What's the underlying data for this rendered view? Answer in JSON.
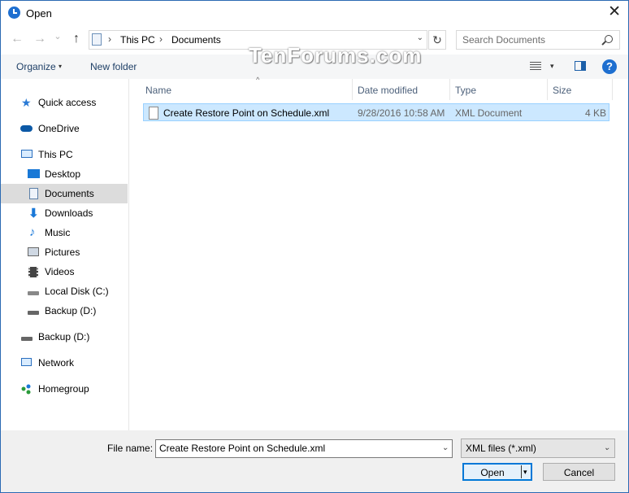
{
  "window": {
    "title": "Open",
    "close_glyph": "✕"
  },
  "nav": {
    "back_glyph": "←",
    "forward_glyph": "→",
    "recent_glyph": "⌄",
    "up_glyph": "↑"
  },
  "address": {
    "crumbs": [
      "This PC",
      "Documents"
    ],
    "separator": "›",
    "dropdown_glyph": "⌄",
    "refresh_glyph": "↻"
  },
  "search": {
    "placeholder": "Search Documents"
  },
  "toolbar": {
    "organize": "Organize",
    "organize_arrow": "▾",
    "new_folder": "New folder",
    "view_arrow": "▾",
    "help": "?"
  },
  "watermark": "TenForums.com",
  "sidebar": {
    "items": [
      {
        "label": "Quick access",
        "icon": "star-icon"
      },
      {
        "label": "OneDrive",
        "icon": "cloud-icon"
      },
      {
        "label": "This PC",
        "icon": "computer-icon"
      },
      {
        "label": "Desktop",
        "icon": "desktop-icon"
      },
      {
        "label": "Documents",
        "icon": "documents-icon"
      },
      {
        "label": "Downloads",
        "icon": "download-icon"
      },
      {
        "label": "Music",
        "icon": "music-icon"
      },
      {
        "label": "Pictures",
        "icon": "pictures-icon"
      },
      {
        "label": "Videos",
        "icon": "videos-icon"
      },
      {
        "label": "Local Disk (C:)",
        "icon": "disk-icon"
      },
      {
        "label": "Backup (D:)",
        "icon": "drive-icon"
      },
      {
        "label": "Backup (D:)",
        "icon": "drive-icon"
      },
      {
        "label": "Network",
        "icon": "network-icon"
      },
      {
        "label": "Homegroup",
        "icon": "homegroup-icon"
      }
    ]
  },
  "table": {
    "sort_glyph": "^",
    "columns": [
      "Name",
      "Date modified",
      "Type",
      "Size"
    ],
    "rows": [
      {
        "name": "Create Restore Point on Schedule.xml",
        "date": "9/28/2016 10:58 AM",
        "type": "XML Document",
        "size": "4 KB"
      }
    ]
  },
  "footer": {
    "file_name_label": "File name:",
    "file_name_value": "Create Restore Point on Schedule.xml",
    "dropdown_glyph": "⌄",
    "filter_value": "XML files (*.xml)",
    "open_label": "Open",
    "open_split_glyph": "▾",
    "cancel_label": "Cancel"
  },
  "colors": {
    "accent": "#0078d7",
    "selection": "#cce8ff",
    "toolbar_bg": "#f5f6f7",
    "footer_bg": "#f0f0f0"
  }
}
